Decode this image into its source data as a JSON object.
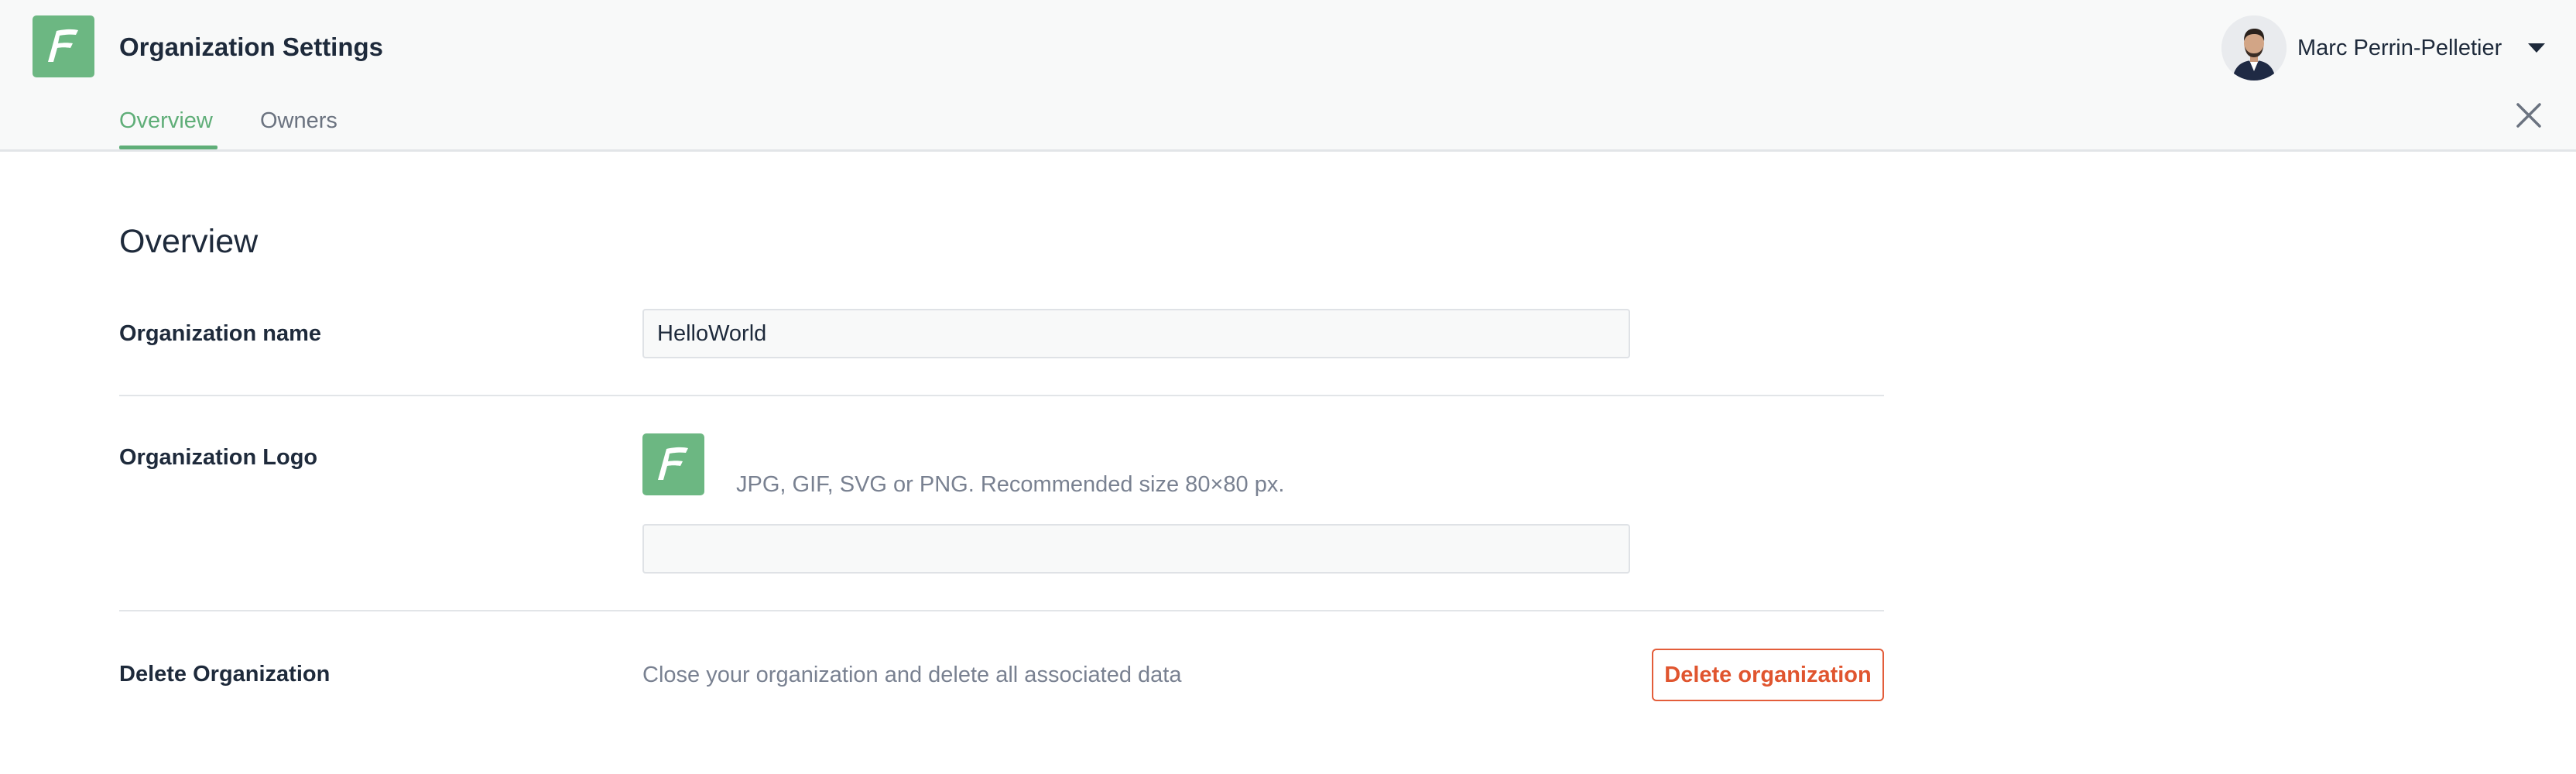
{
  "header": {
    "title": "Organization Settings",
    "user_name": "Marc Perrin-Pelletier",
    "logo_letter": "F"
  },
  "tabs": [
    {
      "label": "Overview",
      "active": true
    },
    {
      "label": "Owners",
      "active": false
    }
  ],
  "main": {
    "section_title": "Overview",
    "org_name": {
      "label": "Organization name",
      "value": "HelloWorld"
    },
    "org_logo": {
      "label": "Organization Logo",
      "hint": "JPG, GIF, SVG or PNG. Recommended size 80×80 px.",
      "input_value": ""
    },
    "delete_org": {
      "label": "Delete Organization",
      "description": "Close your organization and delete all associated data",
      "button_label": "Delete organization"
    }
  },
  "colors": {
    "brand_green": "#6cb782",
    "accent_green": "#5fae78",
    "danger": "#e0552f",
    "text_dark": "#1e2a3b",
    "text_muted": "#798191"
  },
  "icons": [
    "app-logo-icon",
    "avatar",
    "chevron-down-icon",
    "close-icon"
  ]
}
